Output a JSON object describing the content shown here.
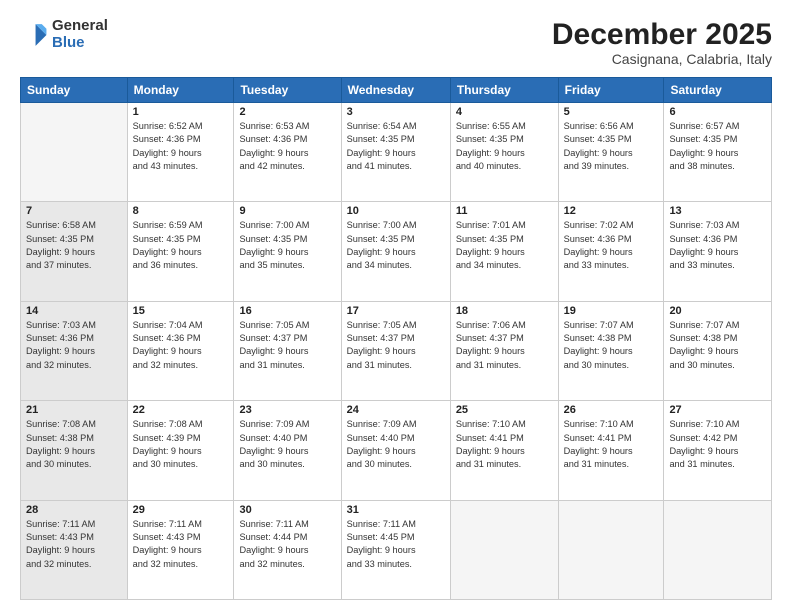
{
  "logo": {
    "general": "General",
    "blue": "Blue"
  },
  "header": {
    "month": "December 2025",
    "location": "Casignana, Calabria, Italy"
  },
  "days_of_week": [
    "Sunday",
    "Monday",
    "Tuesday",
    "Wednesday",
    "Thursday",
    "Friday",
    "Saturday"
  ],
  "weeks": [
    [
      {
        "day": "",
        "info": "",
        "empty": true
      },
      {
        "day": "1",
        "info": "Sunrise: 6:52 AM\nSunset: 4:36 PM\nDaylight: 9 hours\nand 43 minutes."
      },
      {
        "day": "2",
        "info": "Sunrise: 6:53 AM\nSunset: 4:36 PM\nDaylight: 9 hours\nand 42 minutes."
      },
      {
        "day": "3",
        "info": "Sunrise: 6:54 AM\nSunset: 4:35 PM\nDaylight: 9 hours\nand 41 minutes."
      },
      {
        "day": "4",
        "info": "Sunrise: 6:55 AM\nSunset: 4:35 PM\nDaylight: 9 hours\nand 40 minutes."
      },
      {
        "day": "5",
        "info": "Sunrise: 6:56 AM\nSunset: 4:35 PM\nDaylight: 9 hours\nand 39 minutes."
      },
      {
        "day": "6",
        "info": "Sunrise: 6:57 AM\nSunset: 4:35 PM\nDaylight: 9 hours\nand 38 minutes."
      }
    ],
    [
      {
        "day": "7",
        "info": "Sunrise: 6:58 AM\nSunset: 4:35 PM\nDaylight: 9 hours\nand 37 minutes.",
        "shaded": true
      },
      {
        "day": "8",
        "info": "Sunrise: 6:59 AM\nSunset: 4:35 PM\nDaylight: 9 hours\nand 36 minutes."
      },
      {
        "day": "9",
        "info": "Sunrise: 7:00 AM\nSunset: 4:35 PM\nDaylight: 9 hours\nand 35 minutes."
      },
      {
        "day": "10",
        "info": "Sunrise: 7:00 AM\nSunset: 4:35 PM\nDaylight: 9 hours\nand 34 minutes."
      },
      {
        "day": "11",
        "info": "Sunrise: 7:01 AM\nSunset: 4:35 PM\nDaylight: 9 hours\nand 34 minutes."
      },
      {
        "day": "12",
        "info": "Sunrise: 7:02 AM\nSunset: 4:36 PM\nDaylight: 9 hours\nand 33 minutes."
      },
      {
        "day": "13",
        "info": "Sunrise: 7:03 AM\nSunset: 4:36 PM\nDaylight: 9 hours\nand 33 minutes."
      }
    ],
    [
      {
        "day": "14",
        "info": "Sunrise: 7:03 AM\nSunset: 4:36 PM\nDaylight: 9 hours\nand 32 minutes.",
        "shaded": true
      },
      {
        "day": "15",
        "info": "Sunrise: 7:04 AM\nSunset: 4:36 PM\nDaylight: 9 hours\nand 32 minutes."
      },
      {
        "day": "16",
        "info": "Sunrise: 7:05 AM\nSunset: 4:37 PM\nDaylight: 9 hours\nand 31 minutes."
      },
      {
        "day": "17",
        "info": "Sunrise: 7:05 AM\nSunset: 4:37 PM\nDaylight: 9 hours\nand 31 minutes."
      },
      {
        "day": "18",
        "info": "Sunrise: 7:06 AM\nSunset: 4:37 PM\nDaylight: 9 hours\nand 31 minutes."
      },
      {
        "day": "19",
        "info": "Sunrise: 7:07 AM\nSunset: 4:38 PM\nDaylight: 9 hours\nand 30 minutes."
      },
      {
        "day": "20",
        "info": "Sunrise: 7:07 AM\nSunset: 4:38 PM\nDaylight: 9 hours\nand 30 minutes."
      }
    ],
    [
      {
        "day": "21",
        "info": "Sunrise: 7:08 AM\nSunset: 4:38 PM\nDaylight: 9 hours\nand 30 minutes.",
        "shaded": true
      },
      {
        "day": "22",
        "info": "Sunrise: 7:08 AM\nSunset: 4:39 PM\nDaylight: 9 hours\nand 30 minutes."
      },
      {
        "day": "23",
        "info": "Sunrise: 7:09 AM\nSunset: 4:40 PM\nDaylight: 9 hours\nand 30 minutes."
      },
      {
        "day": "24",
        "info": "Sunrise: 7:09 AM\nSunset: 4:40 PM\nDaylight: 9 hours\nand 30 minutes."
      },
      {
        "day": "25",
        "info": "Sunrise: 7:10 AM\nSunset: 4:41 PM\nDaylight: 9 hours\nand 31 minutes."
      },
      {
        "day": "26",
        "info": "Sunrise: 7:10 AM\nSunset: 4:41 PM\nDaylight: 9 hours\nand 31 minutes."
      },
      {
        "day": "27",
        "info": "Sunrise: 7:10 AM\nSunset: 4:42 PM\nDaylight: 9 hours\nand 31 minutes."
      }
    ],
    [
      {
        "day": "28",
        "info": "Sunrise: 7:11 AM\nSunset: 4:43 PM\nDaylight: 9 hours\nand 32 minutes.",
        "shaded": true
      },
      {
        "day": "29",
        "info": "Sunrise: 7:11 AM\nSunset: 4:43 PM\nDaylight: 9 hours\nand 32 minutes."
      },
      {
        "day": "30",
        "info": "Sunrise: 7:11 AM\nSunset: 4:44 PM\nDaylight: 9 hours\nand 32 minutes."
      },
      {
        "day": "31",
        "info": "Sunrise: 7:11 AM\nSunset: 4:45 PM\nDaylight: 9 hours\nand 33 minutes."
      },
      {
        "day": "",
        "info": "",
        "empty": true
      },
      {
        "day": "",
        "info": "",
        "empty": true
      },
      {
        "day": "",
        "info": "",
        "empty": true
      }
    ]
  ]
}
